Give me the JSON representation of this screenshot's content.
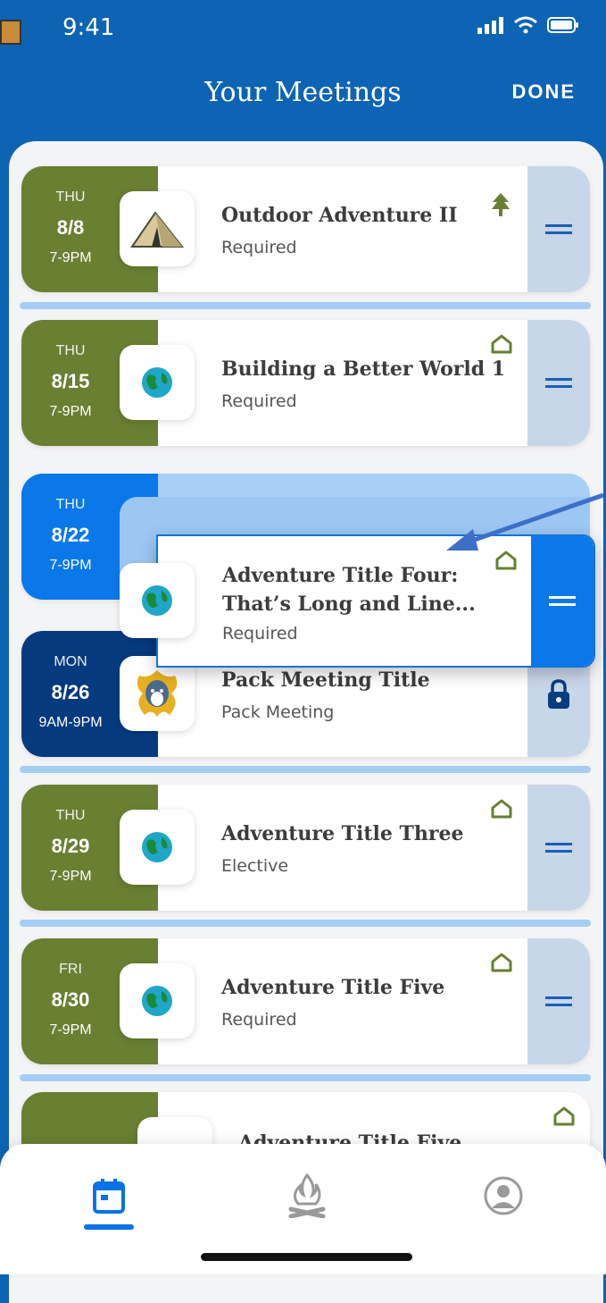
{
  "status": {
    "time": "9:41"
  },
  "header": {
    "title": "Your Meetings",
    "done": "DONE"
  },
  "meetings": [
    {
      "dow": "THU",
      "date": "8/8",
      "time": "7-9PM",
      "title": "Outdoor Adventure II",
      "subtitle": "Required",
      "icon": "tent-icon",
      "badge": "tree-icon",
      "color": "#697f32"
    },
    {
      "dow": "THU",
      "date": "8/15",
      "time": "7-9PM",
      "title": "Building a Better World 1",
      "subtitle": "Required",
      "icon": "globe-icon",
      "badge": "home-outline-icon",
      "color": "#697f32"
    },
    {
      "dow": "THU",
      "date": "8/22",
      "time": "7-9PM",
      "title": "Adventure Title Four: That’s Long and Line...",
      "title_line1": "Adventure Title Four:",
      "title_line2": "That’s Long and Line...",
      "subtitle": "Required",
      "icon": "globe-icon",
      "badge": "home-outline-icon",
      "color": "#0a78e8",
      "state": "dragging"
    },
    {
      "dow": "MON",
      "date": "8/26",
      "time": "9AM-9PM",
      "title": "Pack Meeting Title",
      "subtitle": "Pack Meeting",
      "icon": "wolf-emblem-icon",
      "badge": "",
      "color": "#063a7f",
      "locked": true
    },
    {
      "dow": "THU",
      "date": "8/29",
      "time": "7-9PM",
      "title": "Adventure Title Three",
      "subtitle": "Elective",
      "icon": "globe-icon",
      "badge": "home-outline-icon",
      "color": "#697f32"
    },
    {
      "dow": "FRI",
      "date": "8/30",
      "time": "7-9PM",
      "title": "Adventure Title Five",
      "subtitle": "Required",
      "icon": "globe-icon",
      "badge": "home-outline-icon",
      "color": "#697f32"
    },
    {
      "title": "Adventure Title Five",
      "icon": "globe-icon",
      "badge": "home-outline-icon",
      "color": "#697f32",
      "partial": true
    }
  ],
  "colors": {
    "header": "#0d63b4",
    "olive": "#697f32",
    "active": "#0a78e8",
    "navy": "#063a7f",
    "divider": "#a6cdf4",
    "handle": "#c8d6ea"
  },
  "tabs": [
    {
      "name": "calendar-icon",
      "active": true
    },
    {
      "name": "campfire-icon",
      "active": false
    },
    {
      "name": "profile-icon",
      "active": false
    }
  ]
}
